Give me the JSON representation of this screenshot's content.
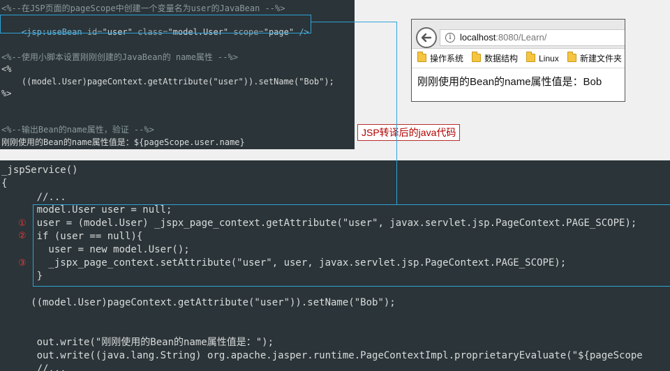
{
  "jsp_code": {
    "line1": "<%--在JSP页面的pageScope中创建一个变量名为user的JavaBean --%>",
    "line2_open": "<jsp:useBean ",
    "line2_id_attr": "id=",
    "line2_id_val": "\"user\"",
    "line2_class_attr": " class=",
    "line2_class_val": "\"model.User\"",
    "line2_scope_attr": " scope=",
    "line2_scope_val": "\"page\"",
    "line2_close": " />",
    "line3": "<%--使用小脚本设置刚刚创建的JavaBean的 name属性 --%>",
    "line4": "<%",
    "line5": "    ((model.User)pageContext.getAttribute(\"user\")).setName(\"Bob\");",
    "line6": "%>",
    "line7": "<%--输出Bean的name属性，验证 --%>",
    "line8": "刚刚使用的Bean的name属性值是：${pageScope.user.name}"
  },
  "browser": {
    "url_host": "localhost",
    "url_rest": ":8080/Learn/",
    "bookmarks": [
      "操作系统",
      "数据结构",
      "Linux",
      "新建文件夹"
    ],
    "content": "刚刚使用的Bean的name属性值是：Bob"
  },
  "annotation_label": "JSP转译后的java代码",
  "java_code": {
    "l1": "_jspService()",
    "l2": "{",
    "l3": "      //...",
    "l4": "      model.User user = null;",
    "l5": "      user = (model.User) _jspx_page_context.getAttribute(\"user\", javax.servlet.jsp.PageContext.PAGE_SCOPE);",
    "l6": "      if (user == null){",
    "l7": "        user = new model.User();",
    "l8": "        _jspx_page_context.setAttribute(\"user\", user, javax.servlet.jsp.PageContext.PAGE_SCOPE);",
    "l9": "      }",
    "l10": "     ((model.User)pageContext.getAttribute(\"user\")).setName(\"Bob\");",
    "l11": "      out.write(\"刚刚使用的Bean的name属性值是：\");",
    "l12": "      out.write((java.lang.String) org.apache.jasper.runtime.PageContextImpl.proprietaryEvaluate(\"${pageScope",
    "l13": "      //..."
  },
  "markers": [
    "①",
    "②",
    "③"
  ],
  "colors": {
    "code_bg": "#2b3438",
    "guide": "#2ea3d8",
    "label_red": "#b00000",
    "marker_red": "#e23a3a"
  }
}
